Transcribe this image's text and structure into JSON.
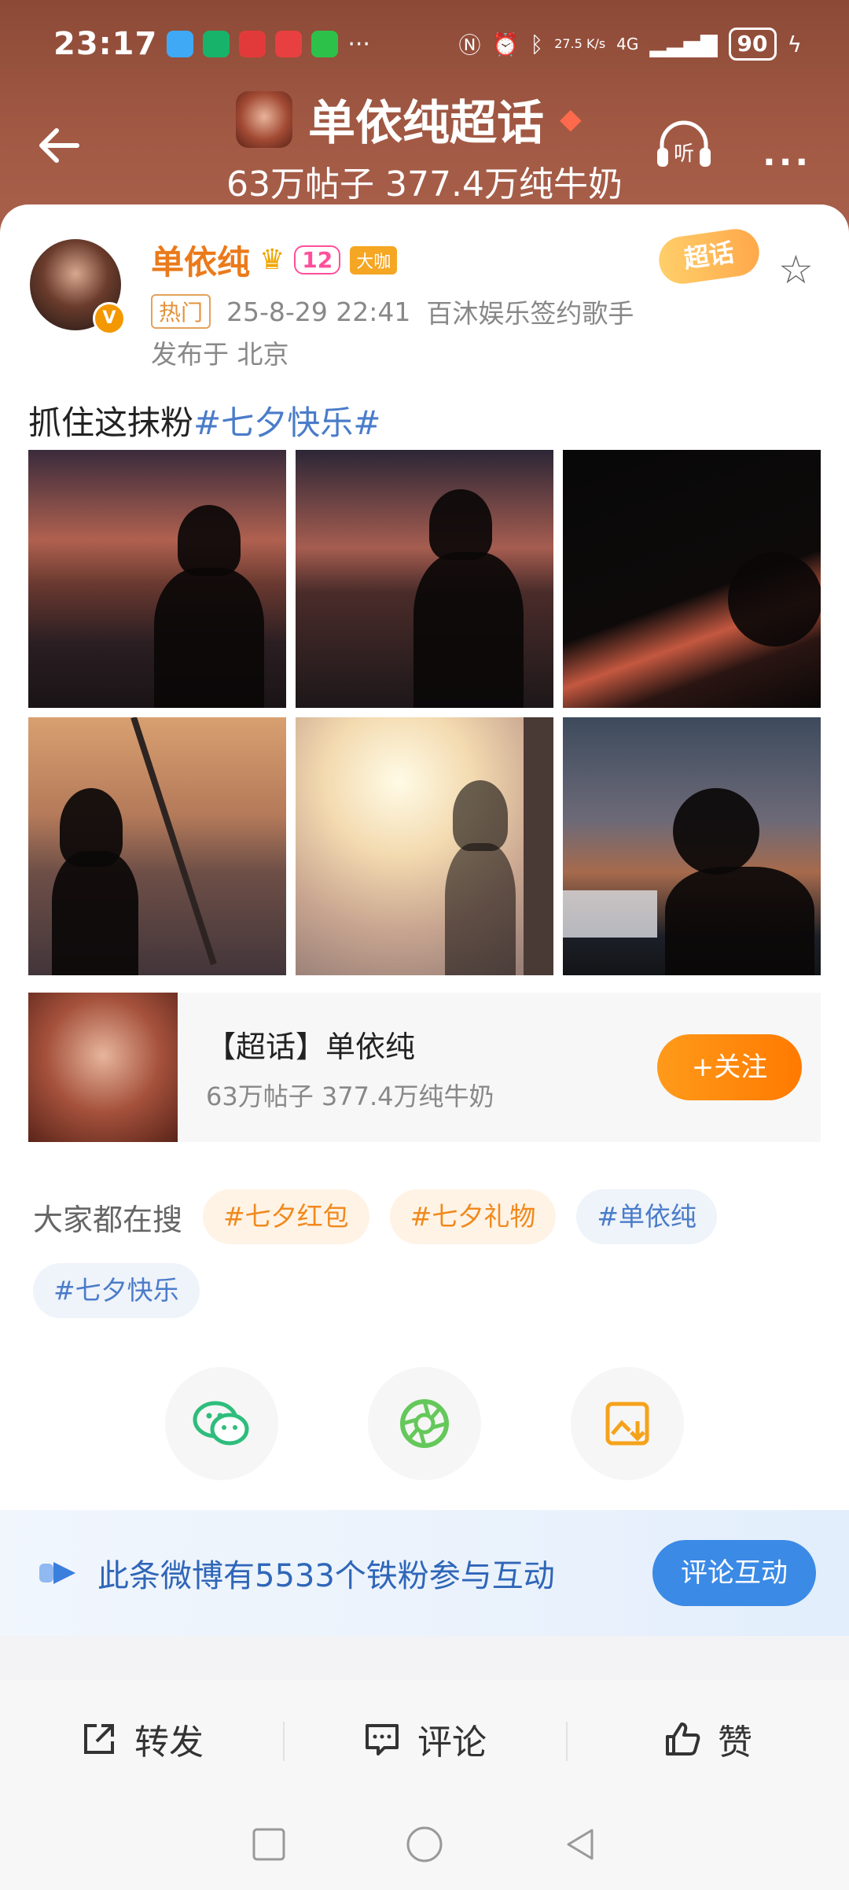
{
  "status_bar": {
    "time": "23:17",
    "network_speed": "27.5 K/s",
    "network_type": "4G",
    "battery": "90"
  },
  "header": {
    "topic_title": "单依纯超话",
    "topic_stats": "63万帖子 377.4万纯牛奶",
    "listen_label": "听",
    "more_label": "..."
  },
  "post": {
    "author": "单依纯",
    "level_badge": "12",
    "daka_badge": "大咖",
    "hot_label": "热门",
    "timestamp": "25-8-29 22:41",
    "author_desc": "百沐娱乐签约歌手",
    "location": "发布于 北京",
    "chaohua_badge": "超话",
    "text_plain": "抓住这抹粉",
    "text_tag": "#七夕快乐#"
  },
  "topic_card": {
    "title": "【超话】单依纯",
    "stats": "63万帖子 377.4万纯牛奶",
    "follow_label": "+关注"
  },
  "searches": {
    "label": "大家都在搜",
    "chips": [
      "#七夕红包",
      "#七夕礼物",
      "#单依纯",
      "#七夕快乐"
    ]
  },
  "fans": {
    "text": "此条微博有5533个铁粉参与互动",
    "button": "评论互动"
  },
  "actions": {
    "repost": "转发",
    "comment": "评论",
    "like": "赞"
  }
}
